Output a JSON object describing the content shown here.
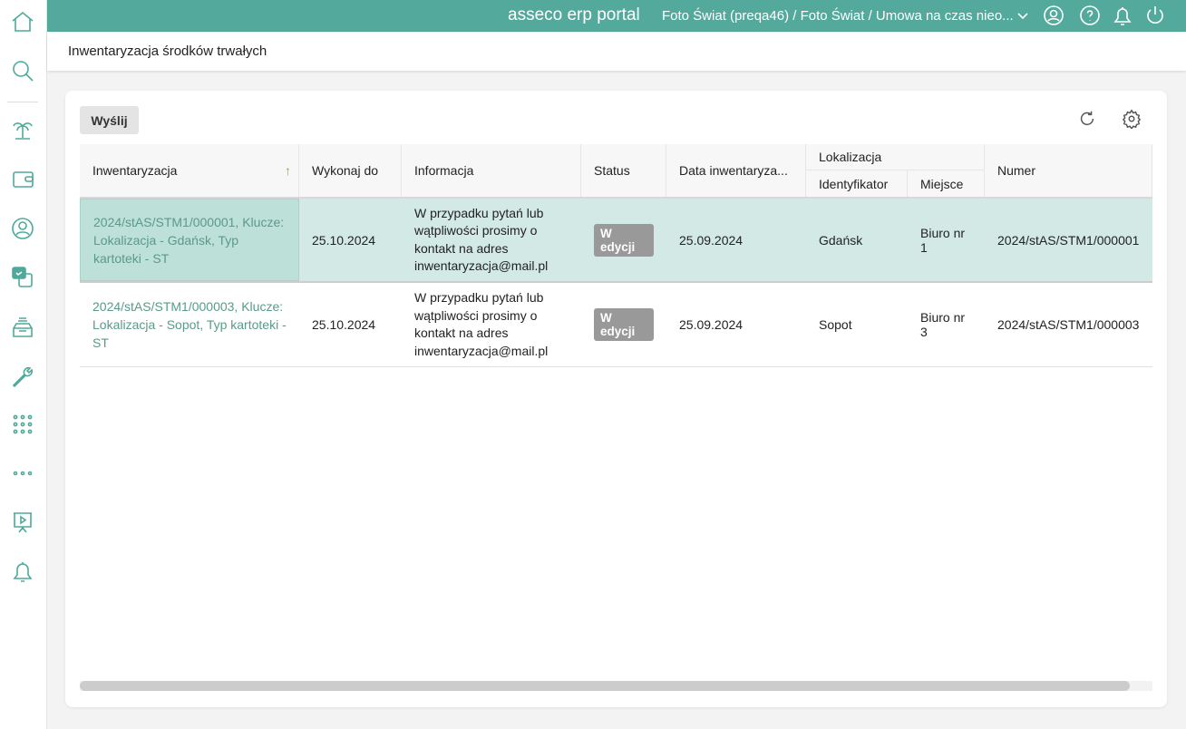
{
  "header": {
    "brand": "asseco erp portal",
    "context": "Foto Świat (preqa46) / Foto Świat / Umowa na czas nieo..."
  },
  "page": {
    "title": "Inwentaryzacja środków trwałych"
  },
  "toolbar": {
    "send_label": "Wyślij"
  },
  "table": {
    "columns": {
      "inwentaryzacja": "Inwentaryzacja",
      "wykonaj": "Wykonaj do",
      "informacja": "Informacja",
      "status": "Status",
      "data": "Data inwentaryza...",
      "lokalizacja": "Lokalizacja",
      "identyfikator": "Identyfikator",
      "miejsce": "Miejsce",
      "numer": "Numer"
    },
    "rows": [
      {
        "inw": "2024/stAS/STM1/000001, Klucze: Lokalizacja - Gdańsk, Typ kartoteki - ST",
        "wykonaj": "25.10.2024",
        "info": "W przypadku pytań lub wątpliwości prosimy o kontakt na adres inwentaryzacja@mail.pl",
        "status": "W edycji",
        "data": "25.09.2024",
        "ident": "Gdańsk",
        "miejsce": "Biuro nr 1",
        "numer": "2024/stAS/STM1/000001"
      },
      {
        "inw": "2024/stAS/STM1/000003, Klucze: Lokalizacja - Sopot, Typ kartoteki - ST",
        "wykonaj": "25.10.2024",
        "info": "W przypadku pytań lub wątpliwości prosimy o kontakt na adres inwentaryzacja@mail.pl",
        "status": "W edycji",
        "data": "25.09.2024",
        "ident": "Sopot",
        "miejsce": "Biuro nr 3",
        "numer": "2024/stAS/STM1/000003"
      }
    ]
  },
  "colors": {
    "accent": "#53aa9c",
    "selected": "#d2e9e5"
  }
}
